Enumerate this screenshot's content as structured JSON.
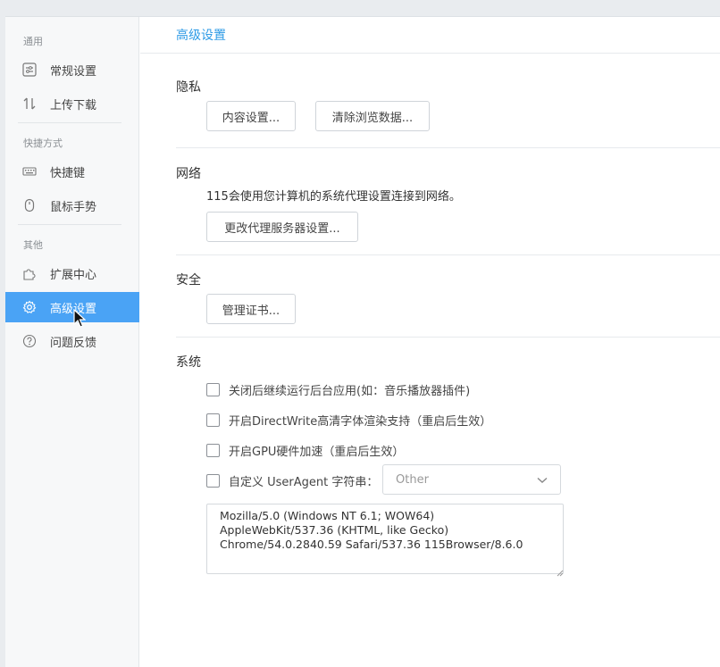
{
  "sidebar": {
    "groups": [
      {
        "title": "通用"
      },
      {
        "title": "快捷方式"
      },
      {
        "title": "其他"
      }
    ],
    "items": [
      {
        "label": "常规设置",
        "icon": "sliders-icon"
      },
      {
        "label": "上传下载",
        "icon": "transfer-icon"
      },
      {
        "label": "快捷键",
        "icon": "keyboard-icon"
      },
      {
        "label": "鼠标手势",
        "icon": "mouse-icon"
      },
      {
        "label": "扩展中心",
        "icon": "puzzle-icon"
      },
      {
        "label": "高级设置",
        "icon": "gear-icon",
        "active": true
      },
      {
        "label": "问题反馈",
        "icon": "help-icon"
      }
    ]
  },
  "main": {
    "title": "高级设置",
    "privacy": {
      "title": "隐私",
      "content_button": "内容设置...",
      "clear_button": "清除浏览数据..."
    },
    "network": {
      "title": "网络",
      "description": "115会使用您计算机的系统代理设置连接到网络。",
      "proxy_button": "更改代理服务器设置..."
    },
    "security": {
      "title": "安全",
      "cert_button": "管理证书..."
    },
    "system": {
      "title": "系统",
      "options": [
        {
          "label": "关闭后继续运行后台应用(如：音乐播放器插件)",
          "checked": false
        },
        {
          "label": "开启DirectWrite高清字体渲染支持（重启后生效）",
          "checked": false
        },
        {
          "label": "开启GPU硬件加速（重启后生效）",
          "checked": false
        },
        {
          "label": "自定义 UserAgent 字符串：",
          "checked": false
        }
      ],
      "ua_select_value": "Other",
      "ua_string": "Mozilla/5.0 (Windows NT 6.1; WOW64)\nAppleWebKit/537.36 (KHTML, like Gecko)\nChrome/54.0.2840.59 Safari/537.36 115Browser/8.6.0"
    }
  },
  "colors": {
    "accent": "#4aa3f5",
    "title_blue": "#2e9be6"
  }
}
